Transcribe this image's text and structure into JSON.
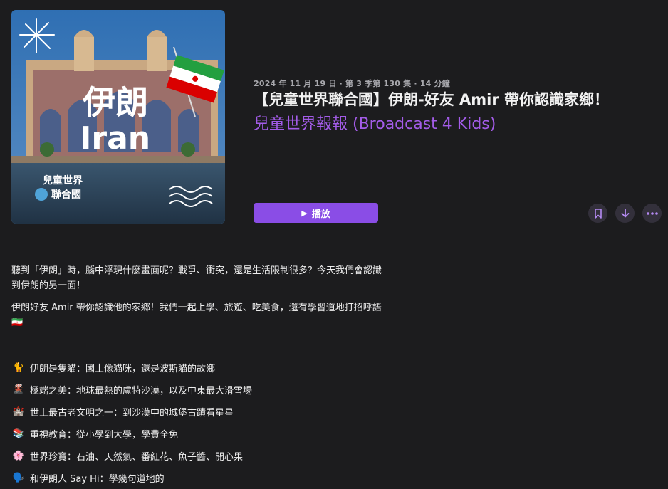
{
  "cover": {
    "title_cn": "伊朗",
    "title_en": "Iran",
    "badge_line1": "兒童世界",
    "badge_line2": "聯合國"
  },
  "episode": {
    "meta": "2024 年 11 月 19 日 · 第 3 季第 130 集 · 14 分鐘",
    "title": "【兒童世界聯合國】伊朗-好友 Amir 帶你認識家鄉！",
    "show": "兒童世界報報 (Broadcast 4 Kids)"
  },
  "actions": {
    "play_label": "播放",
    "bookmark_icon": "bookmark-icon",
    "download_icon": "download-icon",
    "more_icon": "more-icon"
  },
  "colors": {
    "accent": "#8a4de6",
    "show_link": "#a35ce8",
    "background": "#1c1c1e"
  },
  "description": {
    "para1": "聽到「伊朗」時，腦中浮現什麼畫面呢？戰爭、衝突，還是生活限制很多？今天我們會認識到伊朗的另一面！",
    "para2": "伊朗好友 Amir 帶你認識他的家鄉！我們一起上學、旅遊、吃美食，還有學習道地打招呼語 🇮🇷"
  },
  "highlights": [
    {
      "emoji": "🐈",
      "text": "伊朗是隻貓：國土像貓咪，還是波斯貓的故鄉"
    },
    {
      "emoji": "🌋",
      "text": "極端之美：地球最熱的盧特沙漠，以及中東最大滑雪場"
    },
    {
      "emoji": "🏰",
      "text": "世上最古老文明之一：到沙漠中的城堡古蹟看星星"
    },
    {
      "emoji": "📚",
      "text": "重視教育：從小學到大學，學費全免"
    },
    {
      "emoji": "🌸",
      "text": "世界珍寶：石油、天然氣、番紅花、魚子醬、開心果"
    },
    {
      "emoji": "🗣️",
      "text": "和伊朗人 Say Hi：學幾句道地的"
    }
  ]
}
